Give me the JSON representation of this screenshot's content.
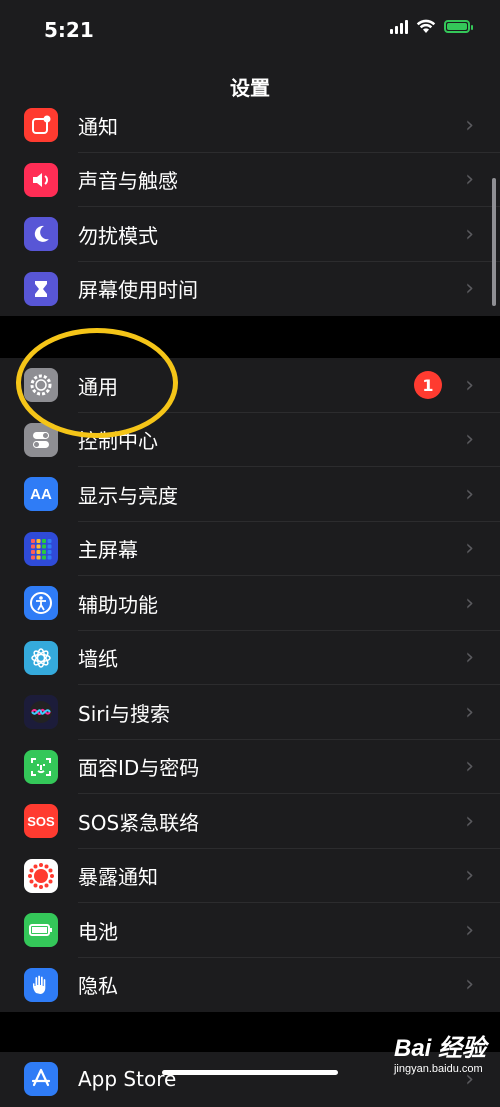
{
  "status_bar": {
    "time": "5:21"
  },
  "header": {
    "title": "设置"
  },
  "groups": [
    {
      "items": [
        {
          "label": "通知",
          "color": "#ff3b30",
          "icon": "notification-icon"
        },
        {
          "label": "声音与触感",
          "color": "#ff2d55",
          "icon": "speaker-icon"
        },
        {
          "label": "勿扰模式",
          "color": "#5856d6",
          "icon": "moon-icon"
        },
        {
          "label": "屏幕使用时间",
          "color": "#5856d6",
          "icon": "hourglass-icon"
        }
      ]
    },
    {
      "items": [
        {
          "label": "通用",
          "color": "#8e8e93",
          "icon": "gear-icon",
          "badge": "1"
        },
        {
          "label": "控制中心",
          "color": "#8e8e93",
          "icon": "toggles-icon"
        },
        {
          "label": "显示与亮度",
          "color": "#2f7cf6",
          "icon": "text-size-icon"
        },
        {
          "label": "主屏幕",
          "color": "#2f4bd8",
          "icon": "app-grid-icon"
        },
        {
          "label": "辅助功能",
          "color": "#2f7cf6",
          "icon": "accessibility-icon"
        },
        {
          "label": "墙纸",
          "color": "#35aadc",
          "icon": "flower-icon"
        },
        {
          "label": "Siri与搜索",
          "color": "#1c1c3a",
          "icon": "siri-icon"
        },
        {
          "label": "面容ID与密码",
          "color": "#34c759",
          "icon": "face-id-icon"
        },
        {
          "label": "SOS紧急联络",
          "color": "#ff3b30",
          "icon": "sos-icon",
          "icon_text": "SOS"
        },
        {
          "label": "暴露通知",
          "color": "#ffffff",
          "icon": "exposure-icon"
        },
        {
          "label": "电池",
          "color": "#34c759",
          "icon": "battery-icon"
        },
        {
          "label": "隐私",
          "color": "#2f7cf6",
          "icon": "hand-icon"
        }
      ]
    },
    {
      "items": [
        {
          "label": "App Store",
          "color": "#2f7cf6",
          "icon": "app-store-icon"
        }
      ]
    }
  ],
  "watermark": {
    "brand": "Bai 经验",
    "sub": "jingyan.baidu.com"
  }
}
